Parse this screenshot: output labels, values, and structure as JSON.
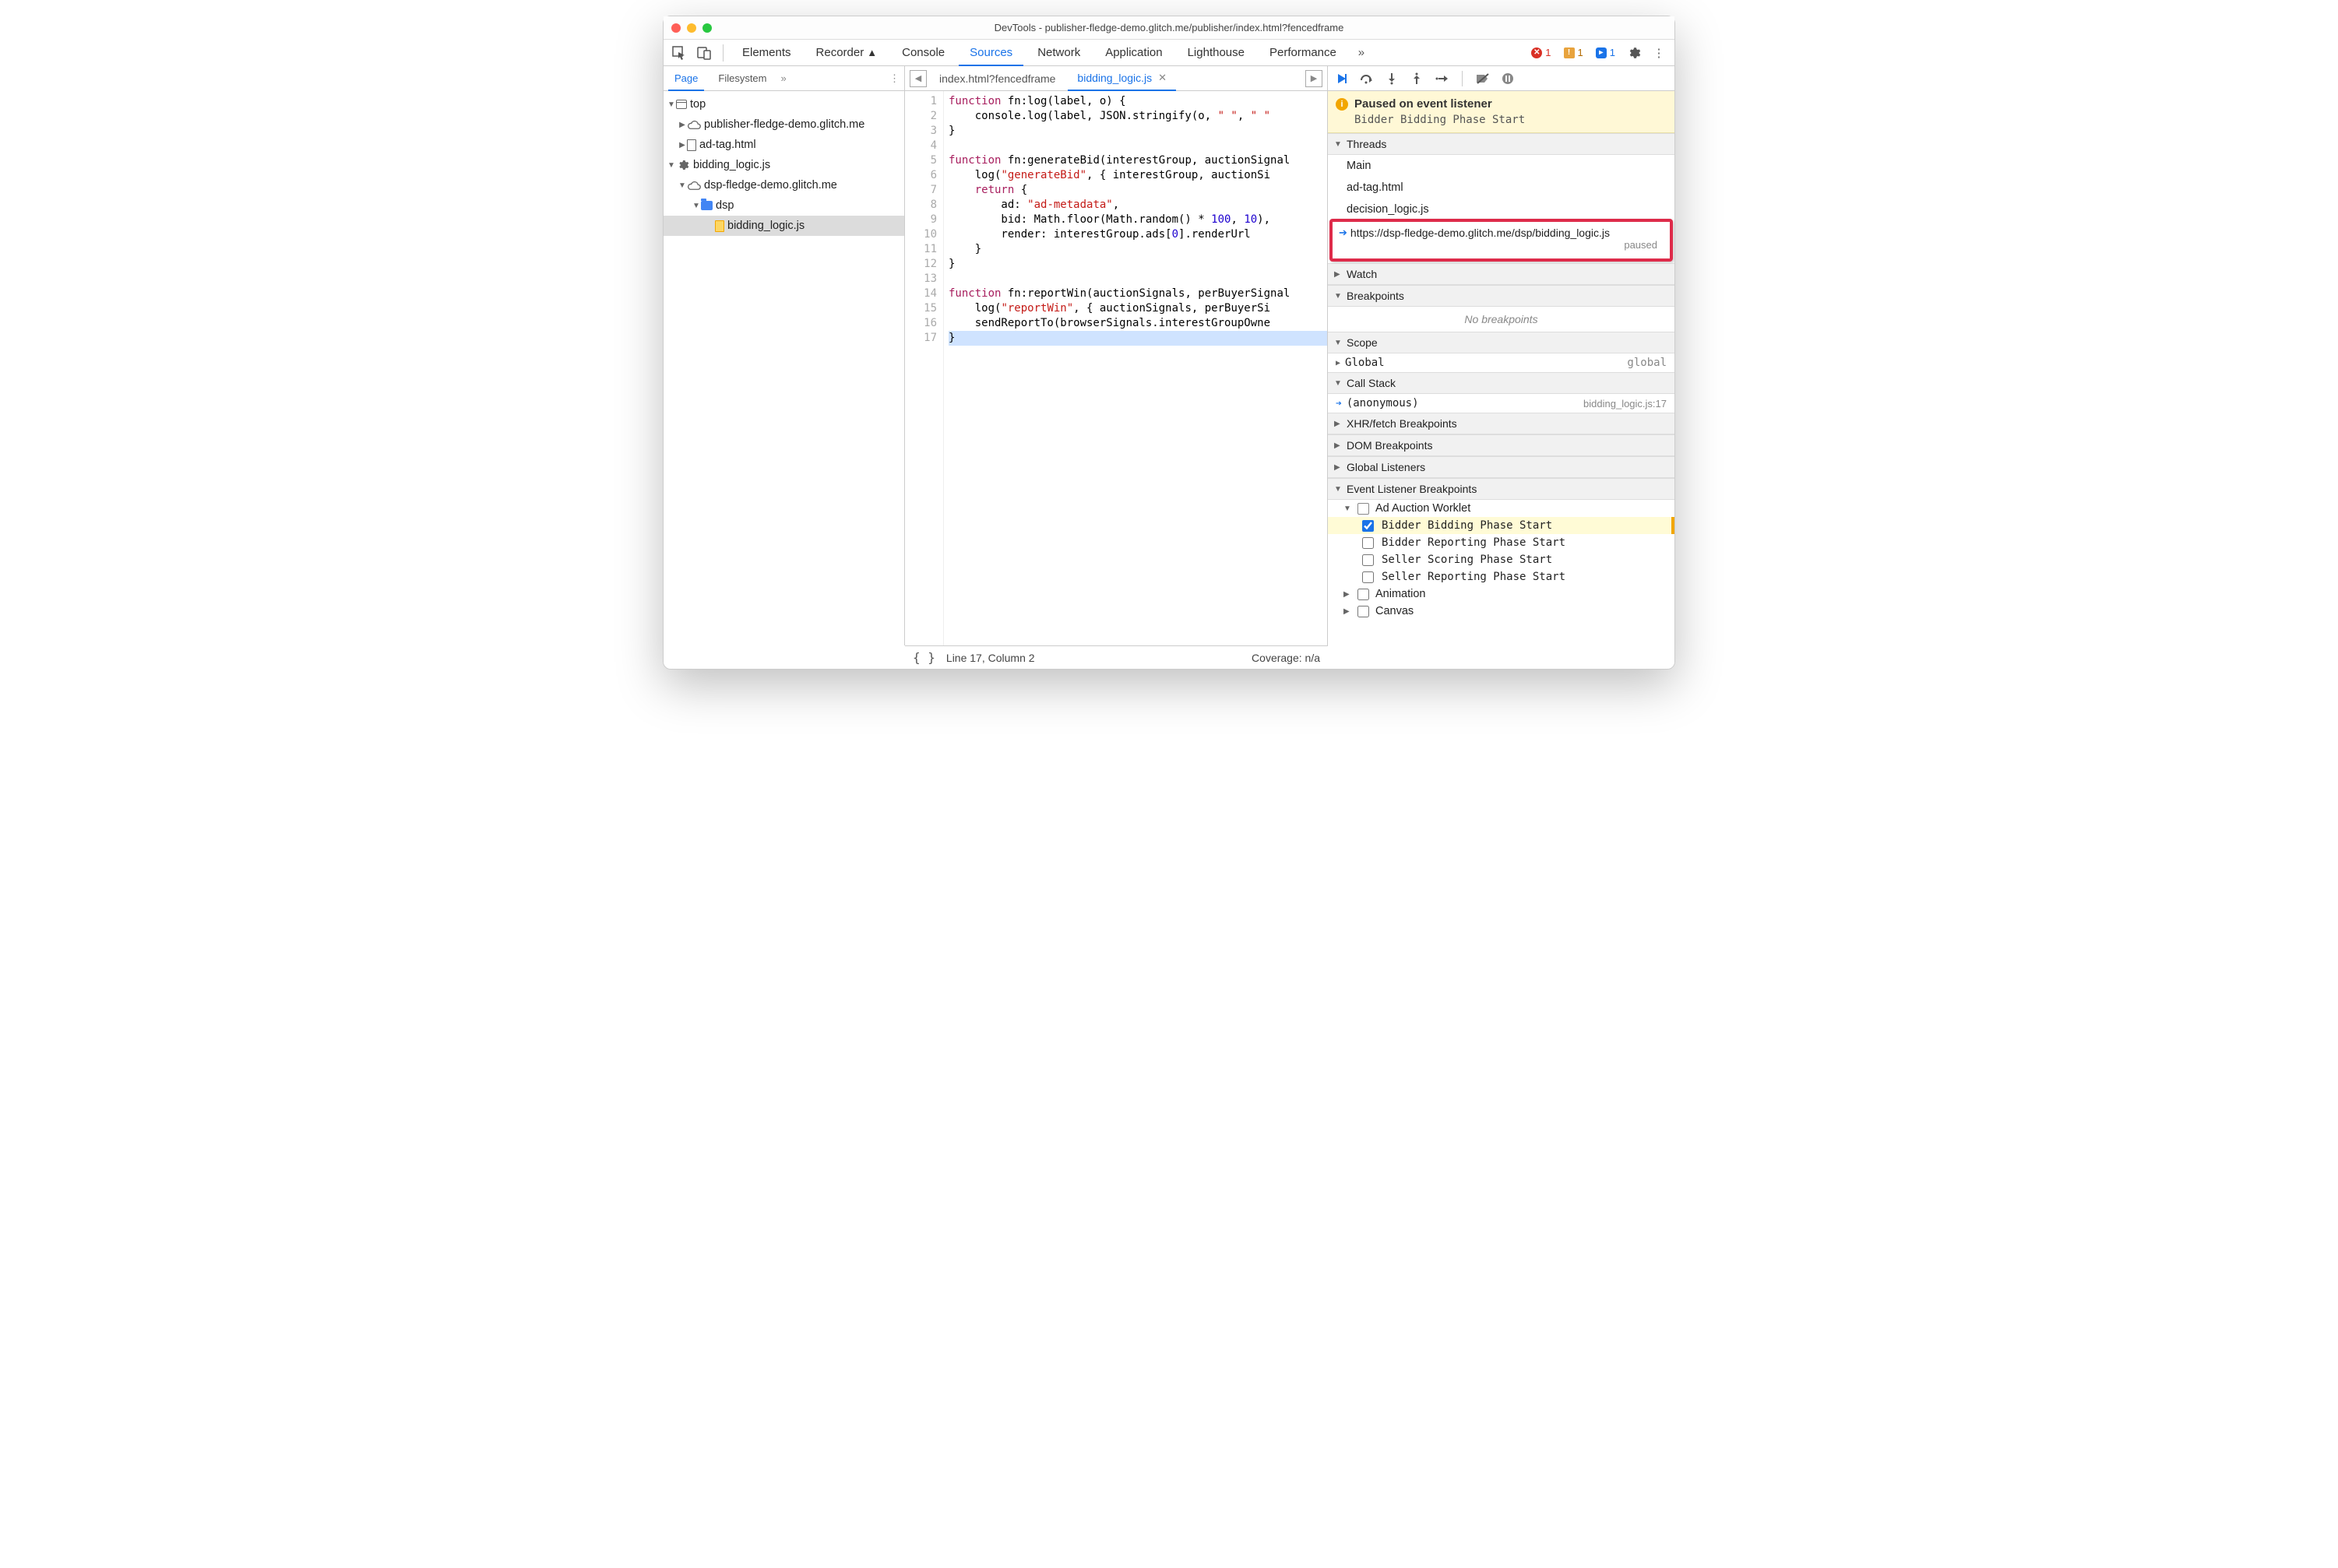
{
  "window": {
    "title": "DevTools - publisher-fledge-demo.glitch.me/publisher/index.html?fencedframe"
  },
  "toolbar": {
    "tabs": [
      "Elements",
      "Recorder",
      "Console",
      "Sources",
      "Network",
      "Application",
      "Lighthouse",
      "Performance"
    ],
    "active_tab": "Sources",
    "errors": "1",
    "warnings": "1",
    "issues": "1"
  },
  "left": {
    "subtabs": [
      "Page",
      "Filesystem"
    ],
    "active_subtab": "Page",
    "tree": {
      "top": "top",
      "domain1": "publisher-fledge-demo.glitch.me",
      "adtag": "ad-tag.html",
      "worklet": "bidding_logic.js",
      "domain2": "dsp-fledge-demo.glitch.me",
      "folder": "dsp",
      "file": "bidding_logic.js"
    }
  },
  "editor": {
    "tabs": [
      {
        "label": "index.html?fencedframe",
        "active": false,
        "closeable": false
      },
      {
        "label": "bidding_logic.js",
        "active": true,
        "closeable": true
      }
    ],
    "gutter_lines": 17,
    "code": [
      [
        "kw:function",
        " fn:log",
        "(label, o) {"
      ],
      [
        "    console.log(label, JSON.stringify(o, ",
        "str:\" \"",
        ", ",
        "str:\" \""
      ],
      [
        "}"
      ],
      [
        ""
      ],
      [
        "kw:function",
        " fn:generateBid",
        "(interestGroup, auctionSignal"
      ],
      [
        "    log(",
        "str:\"generateBid\"",
        ", { interestGroup, auctionSi"
      ],
      [
        "    ",
        "kw:return",
        " {"
      ],
      [
        "        ad: ",
        "str:\"ad-metadata\"",
        ","
      ],
      [
        "        bid: Math.floor(Math.random() * ",
        "num:100",
        ", ",
        "num:10",
        "),"
      ],
      [
        "        render: interestGroup.ads[",
        "num:0",
        "].renderUrl"
      ],
      [
        "    }"
      ],
      [
        "}"
      ],
      [
        ""
      ],
      [
        "kw:function",
        " fn:reportWin",
        "(auctionSignals, perBuyerSignal"
      ],
      [
        "    log(",
        "str:\"reportWin\"",
        ", { auctionSignals, perBuyerSi"
      ],
      [
        "    sendReportTo(browserSignals.interestGroupOwne"
      ],
      [
        "}"
      ]
    ]
  },
  "statusbar": {
    "position": "Line 17, Column 2",
    "coverage": "Coverage: n/a"
  },
  "debugger": {
    "paused": {
      "title": "Paused on event listener",
      "subtitle": "Bidder Bidding Phase Start"
    },
    "sections": {
      "threads": "Threads",
      "watch": "Watch",
      "breakpoints": "Breakpoints",
      "scope": "Scope",
      "callstack": "Call Stack",
      "xhr": "XHR/fetch Breakpoints",
      "dom": "DOM Breakpoints",
      "global": "Global Listeners",
      "evt": "Event Listener Breakpoints"
    },
    "threads": [
      {
        "label": "Main",
        "current": false
      },
      {
        "label": "ad-tag.html",
        "current": false
      },
      {
        "label": "decision_logic.js",
        "current": false
      },
      {
        "label": "https://dsp-fledge-demo.glitch.me/dsp/bidding_logic.js",
        "current": true,
        "status": "paused"
      }
    ],
    "no_breakpoints": "No breakpoints",
    "scope": {
      "global_label": "Global",
      "global_value": "global"
    },
    "callstack": {
      "frame": "(anonymous)",
      "location": "bidding_logic.js:17"
    },
    "event_categories": {
      "ad_auction": "Ad Auction Worklet",
      "animation": "Animation",
      "canvas": "Canvas"
    },
    "event_items": [
      {
        "label": "Bidder Bidding Phase Start",
        "checked": true,
        "hl": true
      },
      {
        "label": "Bidder Reporting Phase Start",
        "checked": false,
        "hl": false
      },
      {
        "label": "Seller Scoring Phase Start",
        "checked": false,
        "hl": false
      },
      {
        "label": "Seller Reporting Phase Start",
        "checked": false,
        "hl": false
      }
    ]
  }
}
